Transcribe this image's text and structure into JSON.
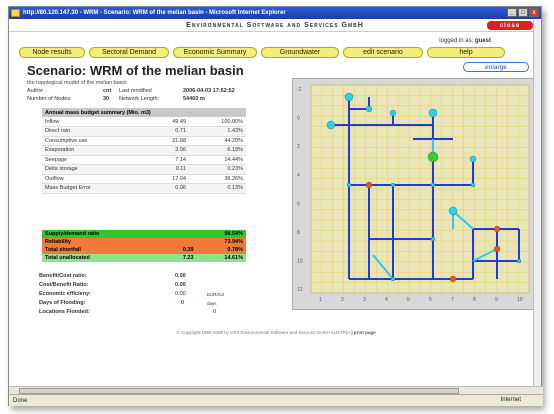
{
  "window": {
    "title": "http://80.120.147.30 - WRM - Scenario: WRM of the melian basin - Microsoft Internet Explorer",
    "min": "_",
    "max": "□",
    "close": "x"
  },
  "banner": {
    "text": "Environmental Software and Services GmbH",
    "close_label": "close"
  },
  "login": {
    "prefix": "logged in as:",
    "user": "guest"
  },
  "nav": [
    {
      "label": "Node results"
    },
    {
      "label": "Sectoral Demand"
    },
    {
      "label": "Economic Summary"
    },
    {
      "label": "Groundwater"
    },
    {
      "label": "edit scenario"
    },
    {
      "label": "help"
    }
  ],
  "enlarge_label": "enlarge",
  "scenario": {
    "title": "Scenario: WRM of the melian basin",
    "subtitle": "the topological model of the melian basin",
    "author_label": "Author",
    "author": "cnt",
    "last_modified_label": "Last modified",
    "last_modified": "2006-04-03 17:52:52",
    "nodes_label": "Number of Nodes:",
    "nodes": "30",
    "network_length_label": "Network Length:",
    "network_length": "54460 m"
  },
  "budget": {
    "header": "Annual mass budget summary (Mio. m3)",
    "rows": [
      {
        "label": "Inflow",
        "value": "49.49",
        "pct": "100.00%"
      },
      {
        "label": "Direct rain",
        "value": "0.71",
        "pct": "1.43%"
      },
      {
        "label": "Consumptive use",
        "value": "21.88",
        "pct": "44.20%"
      },
      {
        "label": "Evaporation",
        "value": "3.06",
        "pct": "6.19%"
      },
      {
        "label": "Seepage",
        "value": "7.14",
        "pct": "14.44%"
      },
      {
        "label": "Delta storage",
        "value": "0.11",
        "pct": "0.23%"
      },
      {
        "label": "Outflow",
        "value": "17.94",
        "pct": "36.26%"
      },
      {
        "label": "Mass Budget Error",
        "value": "0.06",
        "pct": "0.13%"
      }
    ]
  },
  "ratios": [
    {
      "label": "Supply/demand ratio",
      "value": "",
      "pct": "98.54%",
      "color": "#2ec82e"
    },
    {
      "label": "Reliability",
      "value": "",
      "pct": "73.94%",
      "color": "#f07a3a"
    },
    {
      "label": "Total shortfall",
      "value": "0.39",
      "pct": "0.78%",
      "color": "#f07a3a"
    },
    {
      "label": "Total unallocated",
      "value": "7.23",
      "pct": "14.61%",
      "color": "#8ee28e"
    }
  ],
  "benefit": {
    "bc_label": "Benefit/Cost ratio:",
    "bc": "0.00",
    "cb_label": "Cost/Benefit Ratio:",
    "cb": "0.00",
    "eff_label": "Economic efficieny:",
    "eff": "0.00",
    "eff_unit": "EUR/m3",
    "flood_label": "Days of Flooding:",
    "flood": "0",
    "flood_unit": "days",
    "loc_label": "Locations Flooded:",
    "loc": "0"
  },
  "footer": {
    "text": "© Copyright 1995-2005 by ESS Environmental Software and Services GmbH AUSTRIA",
    "print": "| print page"
  },
  "status": {
    "left": "Done",
    "zone": "Internet"
  },
  "map": {
    "y_ticks": [
      "-2",
      "0",
      "2",
      "4",
      "6",
      "8",
      "10",
      "12"
    ],
    "x_ticks": [
      "1",
      "2",
      "3",
      "4",
      "5",
      "6",
      "7",
      "8",
      "9",
      "10"
    ],
    "colors": {
      "river": "#1f3bd1",
      "canal": "#2ec8f0",
      "node_cyan": "#22d3f5",
      "node_orange": "#e06010",
      "node_green": "#2ed22e"
    }
  }
}
